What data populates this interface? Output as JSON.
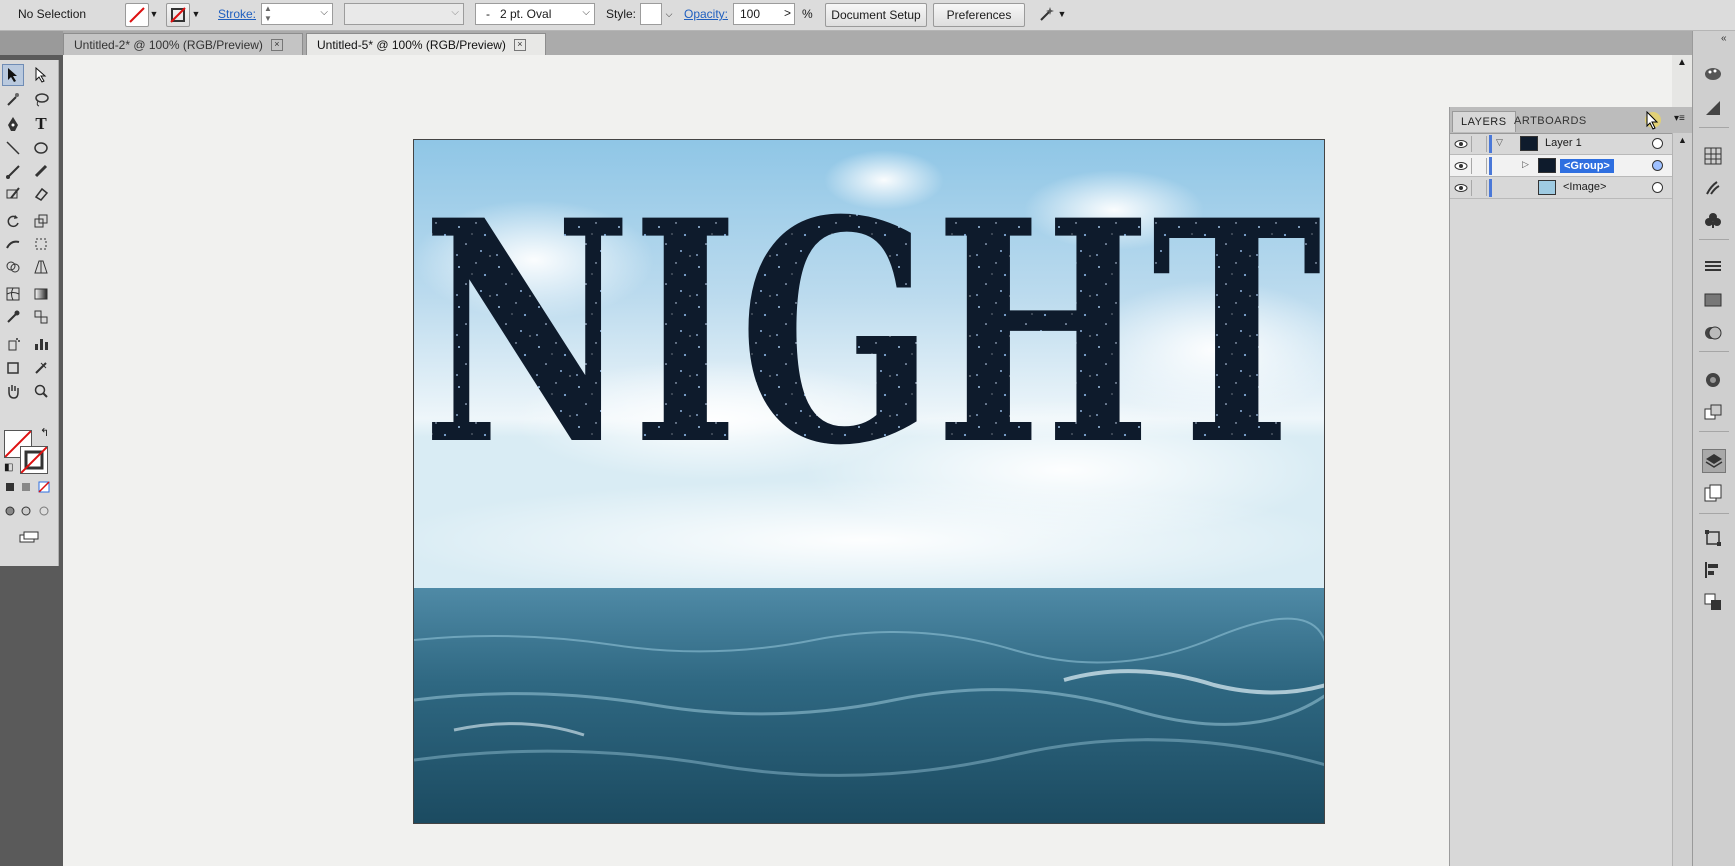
{
  "control_bar": {
    "selection": "No Selection",
    "stroke_label": "Stroke:",
    "brush": "2 pt. Oval",
    "brush_dash": "-",
    "style_label": "Style:",
    "opacity_label": "Opacity:",
    "opacity_value": "100",
    "percent": "%",
    "document_setup": "Document Setup",
    "preferences": "Preferences"
  },
  "tabs": [
    {
      "label": "Untitled-2* @ 100% (RGB/Preview)"
    },
    {
      "label": "Untitled-5* @ 100% (RGB/Preview)"
    }
  ],
  "artwork": {
    "text": "NIGHT"
  },
  "layers_panel": {
    "tab_layers": "LAYERS",
    "tab_artboards": "ARTBOARDS",
    "rows": [
      {
        "name": "Layer 1"
      },
      {
        "name": "<Group>"
      },
      {
        "name": "<Image>"
      }
    ]
  },
  "colors": {
    "selection_blue": "#2f6fe0",
    "layer_color": "#4a78d8"
  }
}
